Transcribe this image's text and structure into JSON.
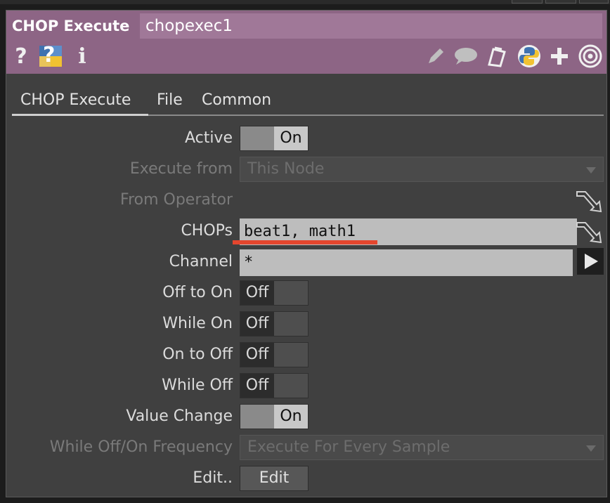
{
  "header": {
    "op_type": "CHOP Execute",
    "op_name": "chopexec1"
  },
  "tabs": [
    {
      "label": "CHOP Execute",
      "active": true
    },
    {
      "label": "File",
      "active": false
    },
    {
      "label": "Common",
      "active": false
    }
  ],
  "params": {
    "active": {
      "label": "Active",
      "value": "On"
    },
    "execute_from": {
      "label": "Execute from",
      "value": "This Node"
    },
    "from_operator": {
      "label": "From Operator"
    },
    "chops": {
      "label": "CHOPs",
      "value": "beat1, math1"
    },
    "channel": {
      "label": "Channel",
      "value": "*"
    },
    "off_to_on": {
      "label": "Off to On",
      "value": "Off"
    },
    "while_on": {
      "label": "While On",
      "value": "Off"
    },
    "on_to_off": {
      "label": "On to Off",
      "value": "Off"
    },
    "while_off": {
      "label": "While Off",
      "value": "Off"
    },
    "value_change": {
      "label": "Value Change",
      "value": "On"
    },
    "frequency": {
      "label": "While Off/On Frequency",
      "value": "Execute For Every Sample"
    },
    "edit": {
      "label": "Edit..",
      "button": "Edit"
    }
  },
  "header_icons_left": {
    "help": "?",
    "python_help": "?",
    "info": "i"
  },
  "colors": {
    "header": "#8d6585",
    "annotation": "#e4462e"
  }
}
